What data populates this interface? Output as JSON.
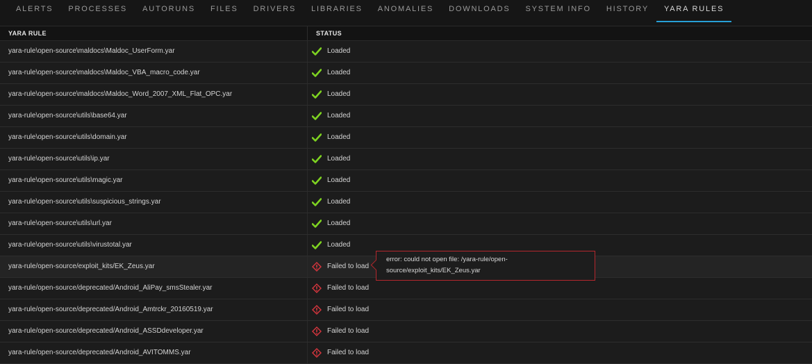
{
  "tabs": [
    "ALERTS",
    "PROCESSES",
    "AUTORUNS",
    "FILES",
    "DRIVERS",
    "LIBRARIES",
    "ANOMALIES",
    "DOWNLOADS",
    "SYSTEM INFO",
    "HISTORY",
    "YARA RULES"
  ],
  "active_tab": "YARA RULES",
  "table": {
    "headers": {
      "rule": "YARA RULE",
      "status": "STATUS"
    },
    "rows": [
      {
        "rule": "yara-rule\\open-source\\maldocs\\Maldoc_UserForm.yar",
        "status": "Loaded",
        "state": "ok"
      },
      {
        "rule": "yara-rule\\open-source\\maldocs\\Maldoc_VBA_macro_code.yar",
        "status": "Loaded",
        "state": "ok"
      },
      {
        "rule": "yara-rule\\open-source\\maldocs\\Maldoc_Word_2007_XML_Flat_OPC.yar",
        "status": "Loaded",
        "state": "ok"
      },
      {
        "rule": "yara-rule\\open-source\\utils\\base64.yar",
        "status": "Loaded",
        "state": "ok"
      },
      {
        "rule": "yara-rule\\open-source\\utils\\domain.yar",
        "status": "Loaded",
        "state": "ok"
      },
      {
        "rule": "yara-rule\\open-source\\utils\\ip.yar",
        "status": "Loaded",
        "state": "ok"
      },
      {
        "rule": "yara-rule\\open-source\\utils\\magic.yar",
        "status": "Loaded",
        "state": "ok"
      },
      {
        "rule": "yara-rule\\open-source\\utils\\suspicious_strings.yar",
        "status": "Loaded",
        "state": "ok"
      },
      {
        "rule": "yara-rule\\open-source\\utils\\url.yar",
        "status": "Loaded",
        "state": "ok"
      },
      {
        "rule": "yara-rule\\open-source\\utils\\virustotal.yar",
        "status": "Loaded",
        "state": "ok"
      },
      {
        "rule": "yara-rule/open-source/exploit_kits/EK_Zeus.yar",
        "status": "Failed to load",
        "state": "error",
        "highlighted": true,
        "tooltip": [
          "error: could not open file: /yara-rule/open-",
          "source/exploit_kits/EK_Zeus.yar"
        ]
      },
      {
        "rule": "yara-rule/open-source/deprecated/Android_AliPay_smsStealer.yar",
        "status": "Failed to load",
        "state": "error"
      },
      {
        "rule": "yara-rule/open-source/deprecated/Android_Amtrckr_20160519.yar",
        "status": "Failed to load",
        "state": "error"
      },
      {
        "rule": "yara-rule/open-source/deprecated/Android_ASSDdeveloper.yar",
        "status": "Failed to load",
        "state": "error"
      },
      {
        "rule": "yara-rule/open-source/deprecated/Android_AVITOMMS.yar",
        "status": "Failed to load",
        "state": "error"
      }
    ]
  },
  "icons": {
    "ok": "check-icon",
    "error": "error-diamond-icon"
  },
  "colors": {
    "ok": "#7ed321",
    "error": "#d9363e",
    "accent": "#27a0d6"
  }
}
